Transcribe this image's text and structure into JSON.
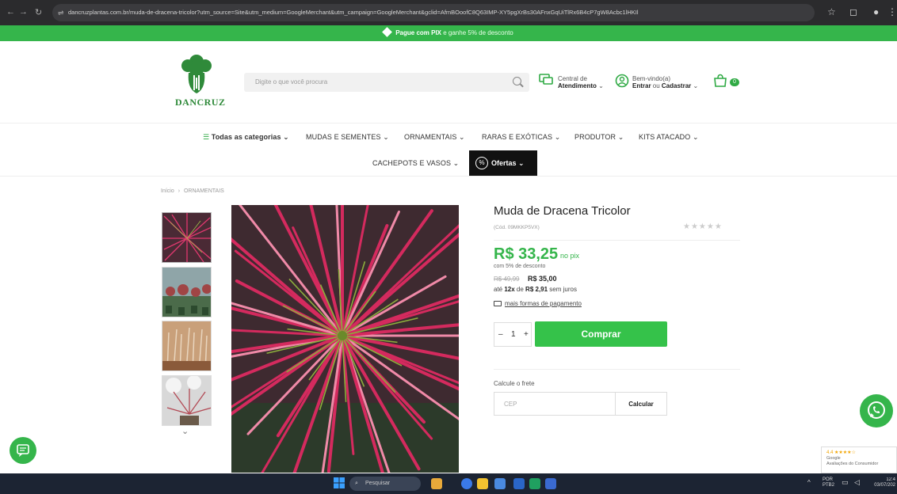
{
  "browser": {
    "url": "dancruzplantas.com.br/muda-de-dracena-tricolor?utm_source=Site&utm_medium=GoogleMerchant&utm_campaign=GoogleMerchant&gclid=AfmBOoofC8Q63IMP-XY5pgXrBs30AFnxGqUiTlRx6B4cP7gW8Acbc1lHKIl"
  },
  "promo": {
    "bold": "Pague com PIX",
    "text": " e ganhe 5% de desconto"
  },
  "header": {
    "logo_text": "DANCRUZ",
    "search_placeholder": "Digite o que você procura",
    "support_line1": "Central de",
    "support_line2": "Atendimento",
    "account_line1": "Bem-vindo(a)",
    "account_enter": "Entrar",
    "account_or": " ou ",
    "account_register": "Cadastrar",
    "cart_count": "0"
  },
  "nav": {
    "all_categories": "Todas as categorias",
    "items": [
      "MUDAS E SEMENTES",
      "ORNAMENTAIS",
      "RARAS E EXÓTICAS",
      "PRODUTOR",
      "KITS ATACADO",
      "CACHEPOTS E VASOS"
    ],
    "offers": "Ofertas",
    "offers_badge": "%"
  },
  "breadcrumb": {
    "home": "Início",
    "sep": "›",
    "current": "ORNAMENTAIS"
  },
  "product": {
    "title": "Muda de Dracena Tricolor",
    "sku": "(Cód. 09MKKP5VX)",
    "rating": 0,
    "price_pix": "R$ 33,25",
    "price_pix_suffix": "no pix",
    "discount_note": "com 5% de desconto",
    "old_price": "R$ 49,99",
    "price": "R$ 35,00",
    "install_prefix": "até ",
    "install_count": "12x",
    "install_mid": " de ",
    "install_value": "R$ 2,91",
    "install_suffix": " sem juros",
    "more_payment": "mais formas de pagamento",
    "qty_minus": "–",
    "qty": "1",
    "qty_plus": "+",
    "buy": "Comprar",
    "shipping_label": "Calcule o frete",
    "cep_placeholder": "CEP",
    "calc": "Calcular"
  },
  "reviews_widget": {
    "stars": "4.4 ★★★★☆",
    "brand": "Google",
    "label": "Avaliações do Consumidor"
  },
  "taskbar": {
    "search": "Pesquisar",
    "lang1": "POR",
    "lang2": "PTB2",
    "time": "12:4",
    "date": "03/07/202"
  },
  "colors": {
    "brand_green": "#35b54b",
    "buy_green": "#35c24a",
    "dark": "#111111"
  }
}
